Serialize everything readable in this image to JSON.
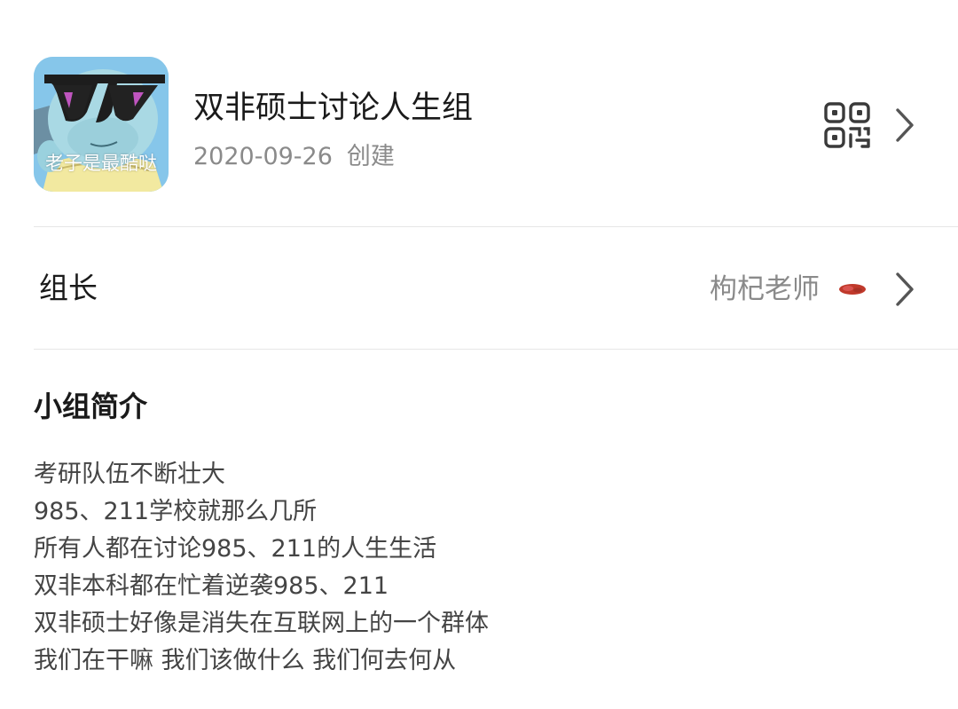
{
  "group": {
    "name": "双非硕士讨论人生组",
    "created_date": "2020-09-26",
    "created_label": "创建",
    "avatar_caption": "老子是最酷哒"
  },
  "leader": {
    "label": "组长",
    "name": "枸杞老师"
  },
  "intro": {
    "heading": "小组简介",
    "lines": [
      "考研队伍不断壮大",
      "985、211学校就那么几所",
      "所有人都在讨论985、211的人生生活",
      "双非本科都在忙着逆袭985、211",
      "双非硕士好像是消失在互联网上的一个群体",
      "我们在干嘛 我们该做什么 我们何去何从"
    ]
  },
  "icons": {
    "qr": "qr-code-icon",
    "chevron": "chevron-right-icon",
    "badge": "leader-badge-icon"
  },
  "colors": {
    "primary_text": "#1a1a1a",
    "secondary_text": "#8a8a8a",
    "body_text": "#444444",
    "divider": "#e6e6e6",
    "badge_red": "#c0392b"
  }
}
